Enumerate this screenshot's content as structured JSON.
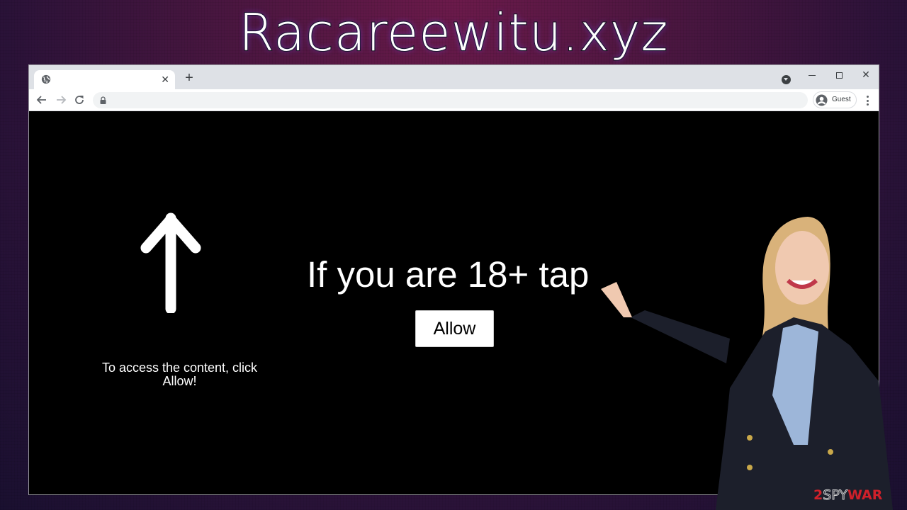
{
  "banner": {
    "title": "Racareewitu.xyz"
  },
  "browser": {
    "tab": {
      "icon": "globe-icon",
      "title": "",
      "close_glyph": "✕"
    },
    "new_tab_glyph": "+",
    "window_controls": {
      "minimize": "minimize-icon",
      "maximize": "maximize-icon",
      "close_glyph": "✕"
    },
    "toolbar": {
      "back": "arrow-left-icon",
      "forward": "arrow-right-icon",
      "reload": "reload-icon",
      "address": "",
      "address_icon": "lock-icon",
      "profile_label": "Guest",
      "menu": "kebab-menu-icon"
    }
  },
  "page": {
    "arrow_icon": "arrow-up-icon",
    "access_text": "To access the content, click Allow!",
    "headline": "If you are 18+ tap",
    "allow_button": "Allow"
  },
  "presenter": {
    "description": "Woman in navy blazer pointing at the headline"
  },
  "watermark": {
    "part1": "2",
    "part2": "SPY",
    "part3": "WAR",
    "colors": {
      "red": "#d0202a"
    }
  },
  "colors": {
    "tabstrip": "#dee1e6",
    "omnibox": "#f1f3f4",
    "page_bg": "#000000"
  }
}
